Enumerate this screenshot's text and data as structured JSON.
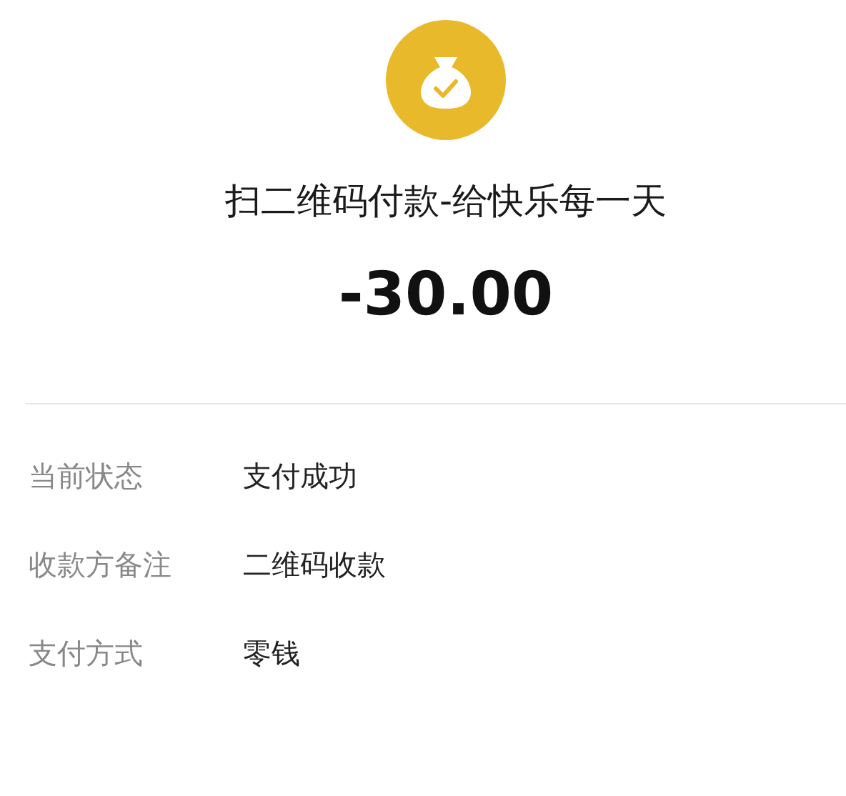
{
  "payment": {
    "title": "扫二维码付款-给快乐每一天",
    "amount": "-30.00"
  },
  "details": [
    {
      "label": "当前状态",
      "value": "支付成功"
    },
    {
      "label": "收款方备注",
      "value": "二维码收款"
    },
    {
      "label": "支付方式",
      "value": "零钱"
    }
  ]
}
